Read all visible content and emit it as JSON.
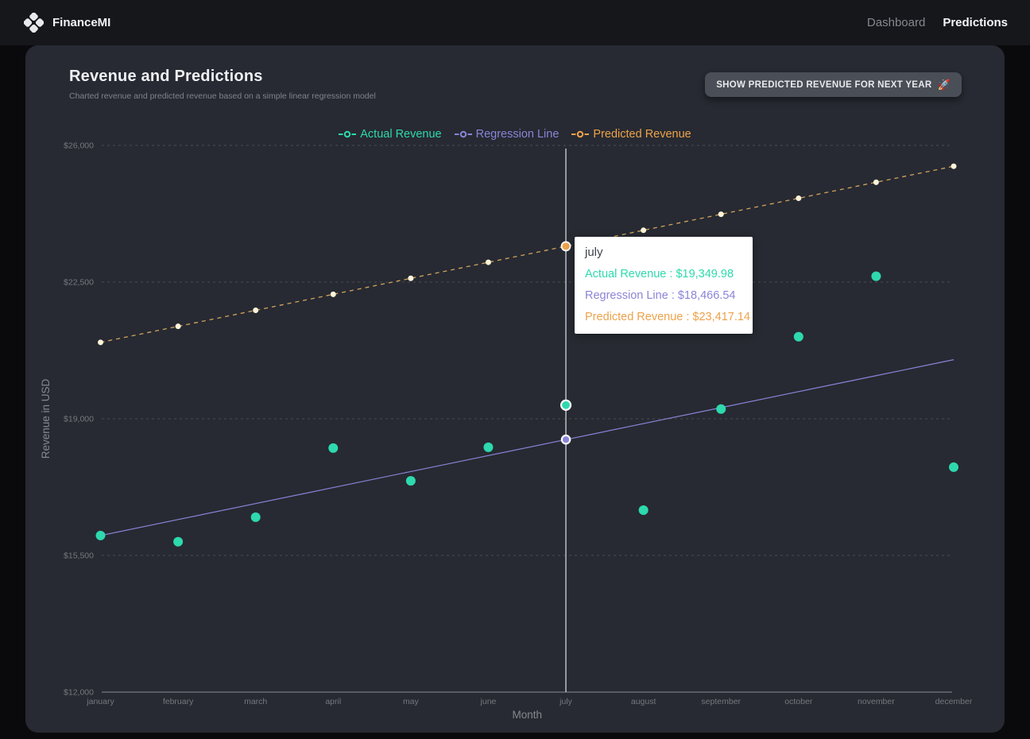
{
  "nav": {
    "brand": "FinanceMI",
    "links": [
      {
        "label": "Dashboard",
        "active": false
      },
      {
        "label": "Predictions",
        "active": true
      }
    ]
  },
  "card": {
    "title": "Revenue and Predictions",
    "subtitle": "Charted revenue and predicted revenue based on a simple linear regression model",
    "button_label": "SHOW PREDICTED REVENUE FOR NEXT YEAR",
    "button_icon": "🚀"
  },
  "chart_data": {
    "type": "line",
    "x": [
      "january",
      "february",
      "march",
      "april",
      "may",
      "june",
      "july",
      "august",
      "september",
      "october",
      "november",
      "december"
    ],
    "xlabel": "Month",
    "ylabel": "Revenue in USD",
    "ylim": [
      12000,
      26000
    ],
    "yticks": [
      {
        "value": 26000,
        "label": "$26,000"
      },
      {
        "value": 22500,
        "label": "$22,500"
      },
      {
        "value": 19000,
        "label": "$19,000"
      },
      {
        "value": 15500,
        "label": "$15,500"
      },
      {
        "value": 12000,
        "label": "$12,000"
      }
    ],
    "grid": "horizontal-dashed",
    "legend_position": "top-center",
    "active_index": 6,
    "active_month": "july",
    "series": [
      {
        "name": "Actual Revenue",
        "type": "scatter",
        "color": "#2ed9ae",
        "values": [
          16010,
          15850,
          16480,
          18250,
          17410,
          18270,
          19349.98,
          16660,
          19250,
          21100,
          22650,
          17760
        ]
      },
      {
        "name": "Regression Line",
        "type": "line",
        "color": "#8884d8",
        "values": [
          16010,
          16419,
          16829,
          17238,
          17648,
          18057,
          18466.54,
          18876,
          19285,
          19695,
          20104,
          20513
        ]
      },
      {
        "name": "Predicted Revenue",
        "type": "dashed-line-with-dots",
        "color": "#eda24a",
        "line_color": "#d2a35f",
        "dot_color": "#fdf4da",
        "values": [
          20957,
          21367,
          21777,
          22187,
          22597,
          23007,
          23417.14,
          23827,
          24237,
          24647,
          25057,
          25467
        ]
      }
    ]
  },
  "tooltip": {
    "title": "july",
    "rows": [
      {
        "label": "Actual Revenue",
        "value": "$19,349.98",
        "color": "#2ed9ae"
      },
      {
        "label": "Regression Line",
        "value": "$18,466.54",
        "color": "#8a85d8"
      },
      {
        "label": "Predicted Revenue",
        "value": "$23,417.14",
        "color": "#eda24a"
      }
    ]
  }
}
